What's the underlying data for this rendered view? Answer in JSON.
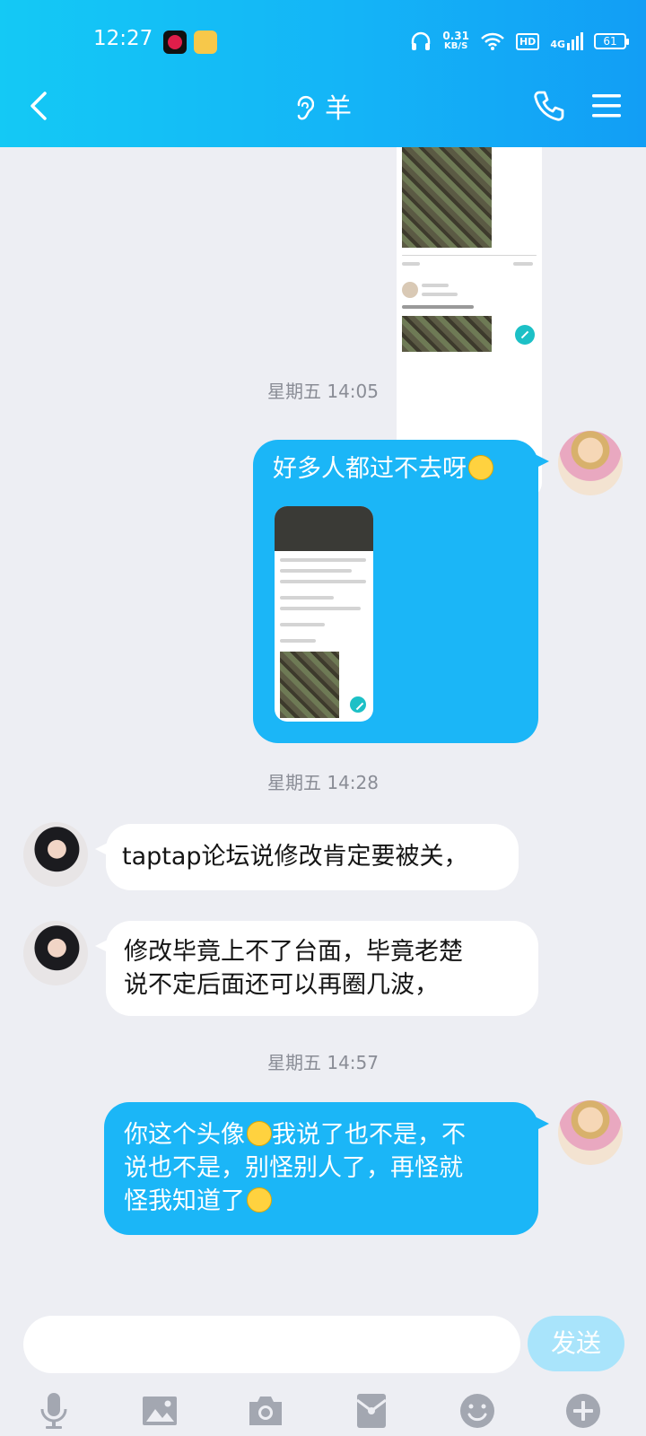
{
  "status_bar": {
    "time": "12:27",
    "net_speed_value": "0.31",
    "net_speed_unit": "KB/S",
    "hd_label": "HD",
    "network_type": "4G",
    "battery": "61"
  },
  "header": {
    "title": "羊",
    "title_icon": "ear-icon"
  },
  "messages": {
    "ts1": "星期五 14:05",
    "m1_text": "好多人都过不去呀",
    "ts2": "星期五 14:28",
    "m2_text": "taptap论坛说修改肯定要被关，",
    "m3_line1": "修改毕竟上不了台面，毕竟老楚",
    "m3_line2": "说不定后面还可以再圈几波，",
    "ts3": "星期五 14:57",
    "m4_line1_a": "你这个头像",
    "m4_line1_b": "我说了也不是，不",
    "m4_line2": "说也不是，别怪别人了，再怪就",
    "m4_line3": "怪我知道了"
  },
  "input_bar": {
    "placeholder": "",
    "send_label": "发送"
  },
  "colors": {
    "header_start": "#14c9f5",
    "header_end": "#129ef5",
    "outgoing_bubble": "#1bb6f7",
    "incoming_bubble": "#ffffff",
    "send_button": "#a9e4fb",
    "background": "#edeef3"
  }
}
